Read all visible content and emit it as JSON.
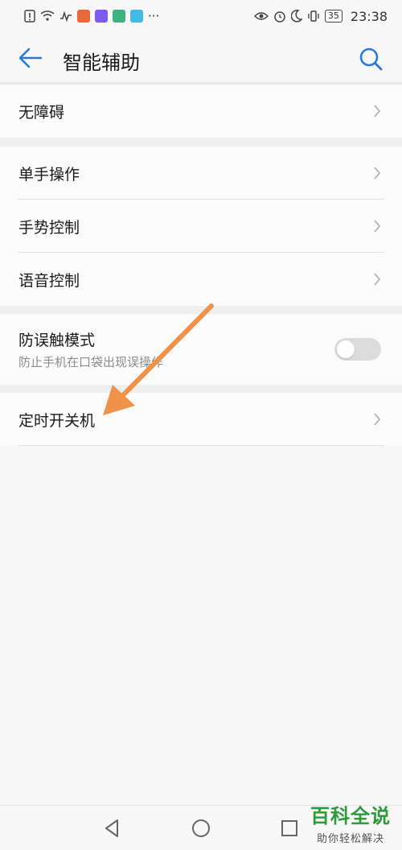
{
  "status_bar": {
    "time": "23:38",
    "battery": "35",
    "more": "···",
    "app_colors": [
      "#e86a3c",
      "#7a5cf0",
      "#3fb37f",
      "#46b8e6"
    ]
  },
  "header": {
    "title": "智能辅助",
    "accent_color": "#2a7bd8"
  },
  "groups": {
    "g1": [
      {
        "label": "无障碍"
      }
    ],
    "g2": [
      {
        "label": "单手操作"
      },
      {
        "label": "手势控制"
      },
      {
        "label": "语音控制"
      }
    ],
    "g3": {
      "label": "防误触模式",
      "subtitle": "防止手机在口袋出现误操作",
      "toggle_on": false
    },
    "g4": [
      {
        "label": "定时开关机"
      }
    ]
  },
  "annotation_arrow_color": "#f0924a",
  "watermark": {
    "title": "百科全说",
    "subtitle": "助你轻松解决",
    "color": "#2e9a3e"
  }
}
